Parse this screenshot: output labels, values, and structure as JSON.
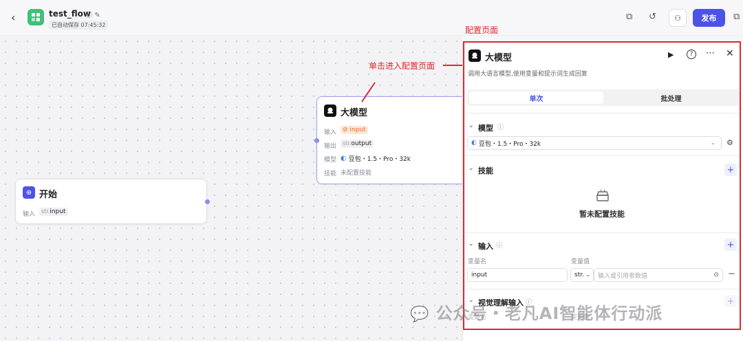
{
  "header": {
    "app_title": "test_flow",
    "saved_status": "已自动保存 07:45:32",
    "publish_label": "发布"
  },
  "annotations": {
    "config_page": "配置页面",
    "click_to_enter": "单击进入配置页面"
  },
  "start_node": {
    "title": "开始",
    "input_label": "输入",
    "input_type": "str.",
    "input_name": "input"
  },
  "llm_node": {
    "title": "大模型",
    "rows": [
      {
        "label": "输入",
        "value": "input"
      },
      {
        "label": "输出",
        "type": "str.",
        "value": "output"
      },
      {
        "label": "模型",
        "value": "豆包・1.5・Pro・32k"
      },
      {
        "label": "技能",
        "value": "未配置技能"
      }
    ]
  },
  "panel": {
    "title": "大模型",
    "description": "调用大语言模型,使用变量和提示词生成回复",
    "tabs": [
      {
        "label": "单次",
        "active": true
      },
      {
        "label": "批处理",
        "active": false
      }
    ],
    "model_section": {
      "title": "模型",
      "selected_model": "豆包・1.5・Pro・32k"
    },
    "skills_section": {
      "title": "技能",
      "empty_text": "暂未配置技能"
    },
    "input_section": {
      "title": "输入",
      "col_name": "变量名",
      "col_value": "变量值",
      "row_name": "input",
      "row_type": "str.",
      "value_placeholder": "输入或引用参数值"
    },
    "vision_section": {
      "title": "视觉理解输入",
      "partial_label": "变量名",
      "partial_value": "变量值"
    }
  },
  "watermark": "公众号・老凡AI智能体行动派",
  "colors": {
    "accent": "#4d53e8",
    "annotation_red": "#e0262f",
    "app_icon_green": "#3ec27a",
    "start_icon": "#4d53e8"
  }
}
